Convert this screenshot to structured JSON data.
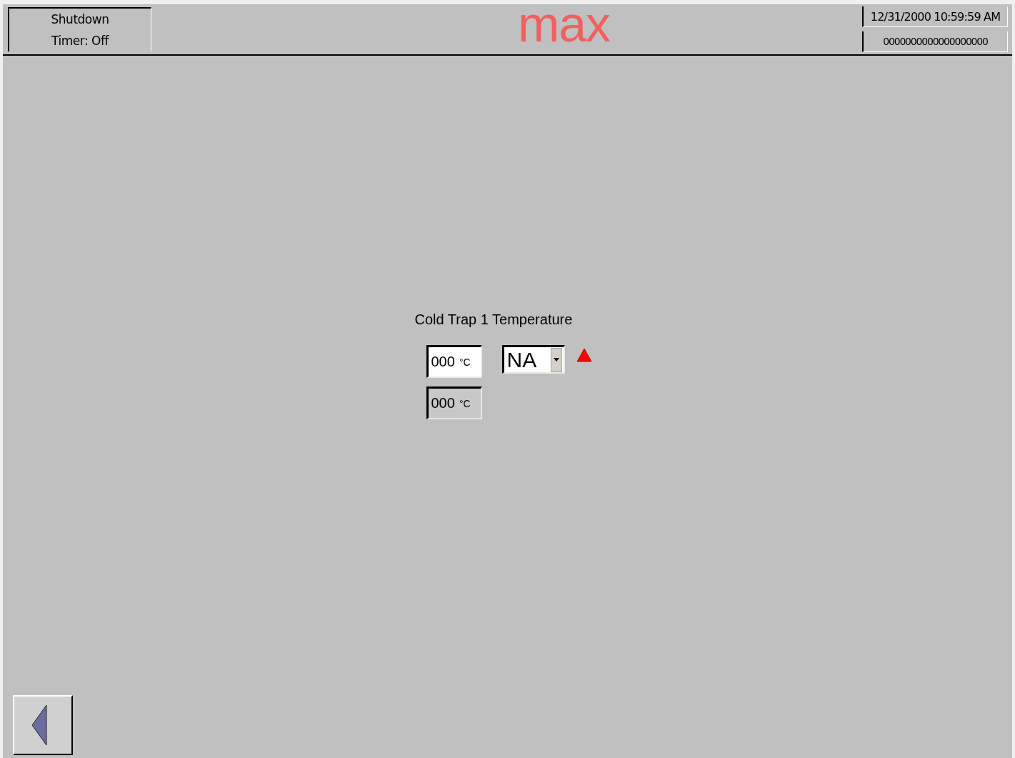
{
  "header": {
    "status_lines": [
      "Shutdown",
      "Timer: Off"
    ],
    "logo": "max",
    "datetime": "12/31/2000  10:59:59 AM",
    "counter": "0000000000000000000"
  },
  "panel": {
    "title": "Cold Trap 1  Temperature",
    "fields": [
      {
        "value": "000",
        "unit": "°C",
        "disabled": false
      },
      {
        "value": "000",
        "unit": "°C",
        "disabled": true
      }
    ],
    "mode_select": {
      "value": "NA"
    },
    "alarm": true
  },
  "back_button": true
}
